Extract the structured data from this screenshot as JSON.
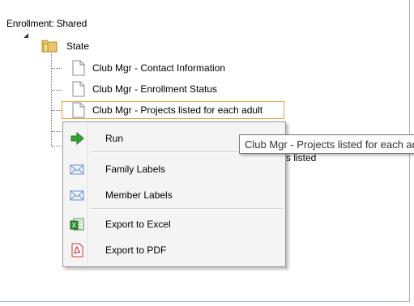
{
  "tree": {
    "root_label": "Enrollment: Shared",
    "folder_label": "State",
    "reports": [
      "Club Mgr - Contact Information",
      "Club Mgr - Enrollment Status",
      "Club Mgr - Projects listed for each adult"
    ],
    "partially_hidden": [
      "s listed"
    ]
  },
  "context_menu": {
    "items": [
      {
        "label": "Run",
        "icon": "run-arrow-icon"
      },
      {
        "label": "Family Labels",
        "icon": "envelope-icon"
      },
      {
        "label": "Member Labels",
        "icon": "envelope-icon"
      },
      {
        "label": "Export to Excel",
        "icon": "excel-icon"
      },
      {
        "label": "Export to PDF",
        "icon": "pdf-icon"
      }
    ]
  },
  "tooltip": {
    "text": "Club Mgr - Projects listed for each adult"
  },
  "colors": {
    "selection_border": "#e8a13a",
    "panel_border": "#9fb6d4",
    "run_green": "#3aa13a"
  }
}
